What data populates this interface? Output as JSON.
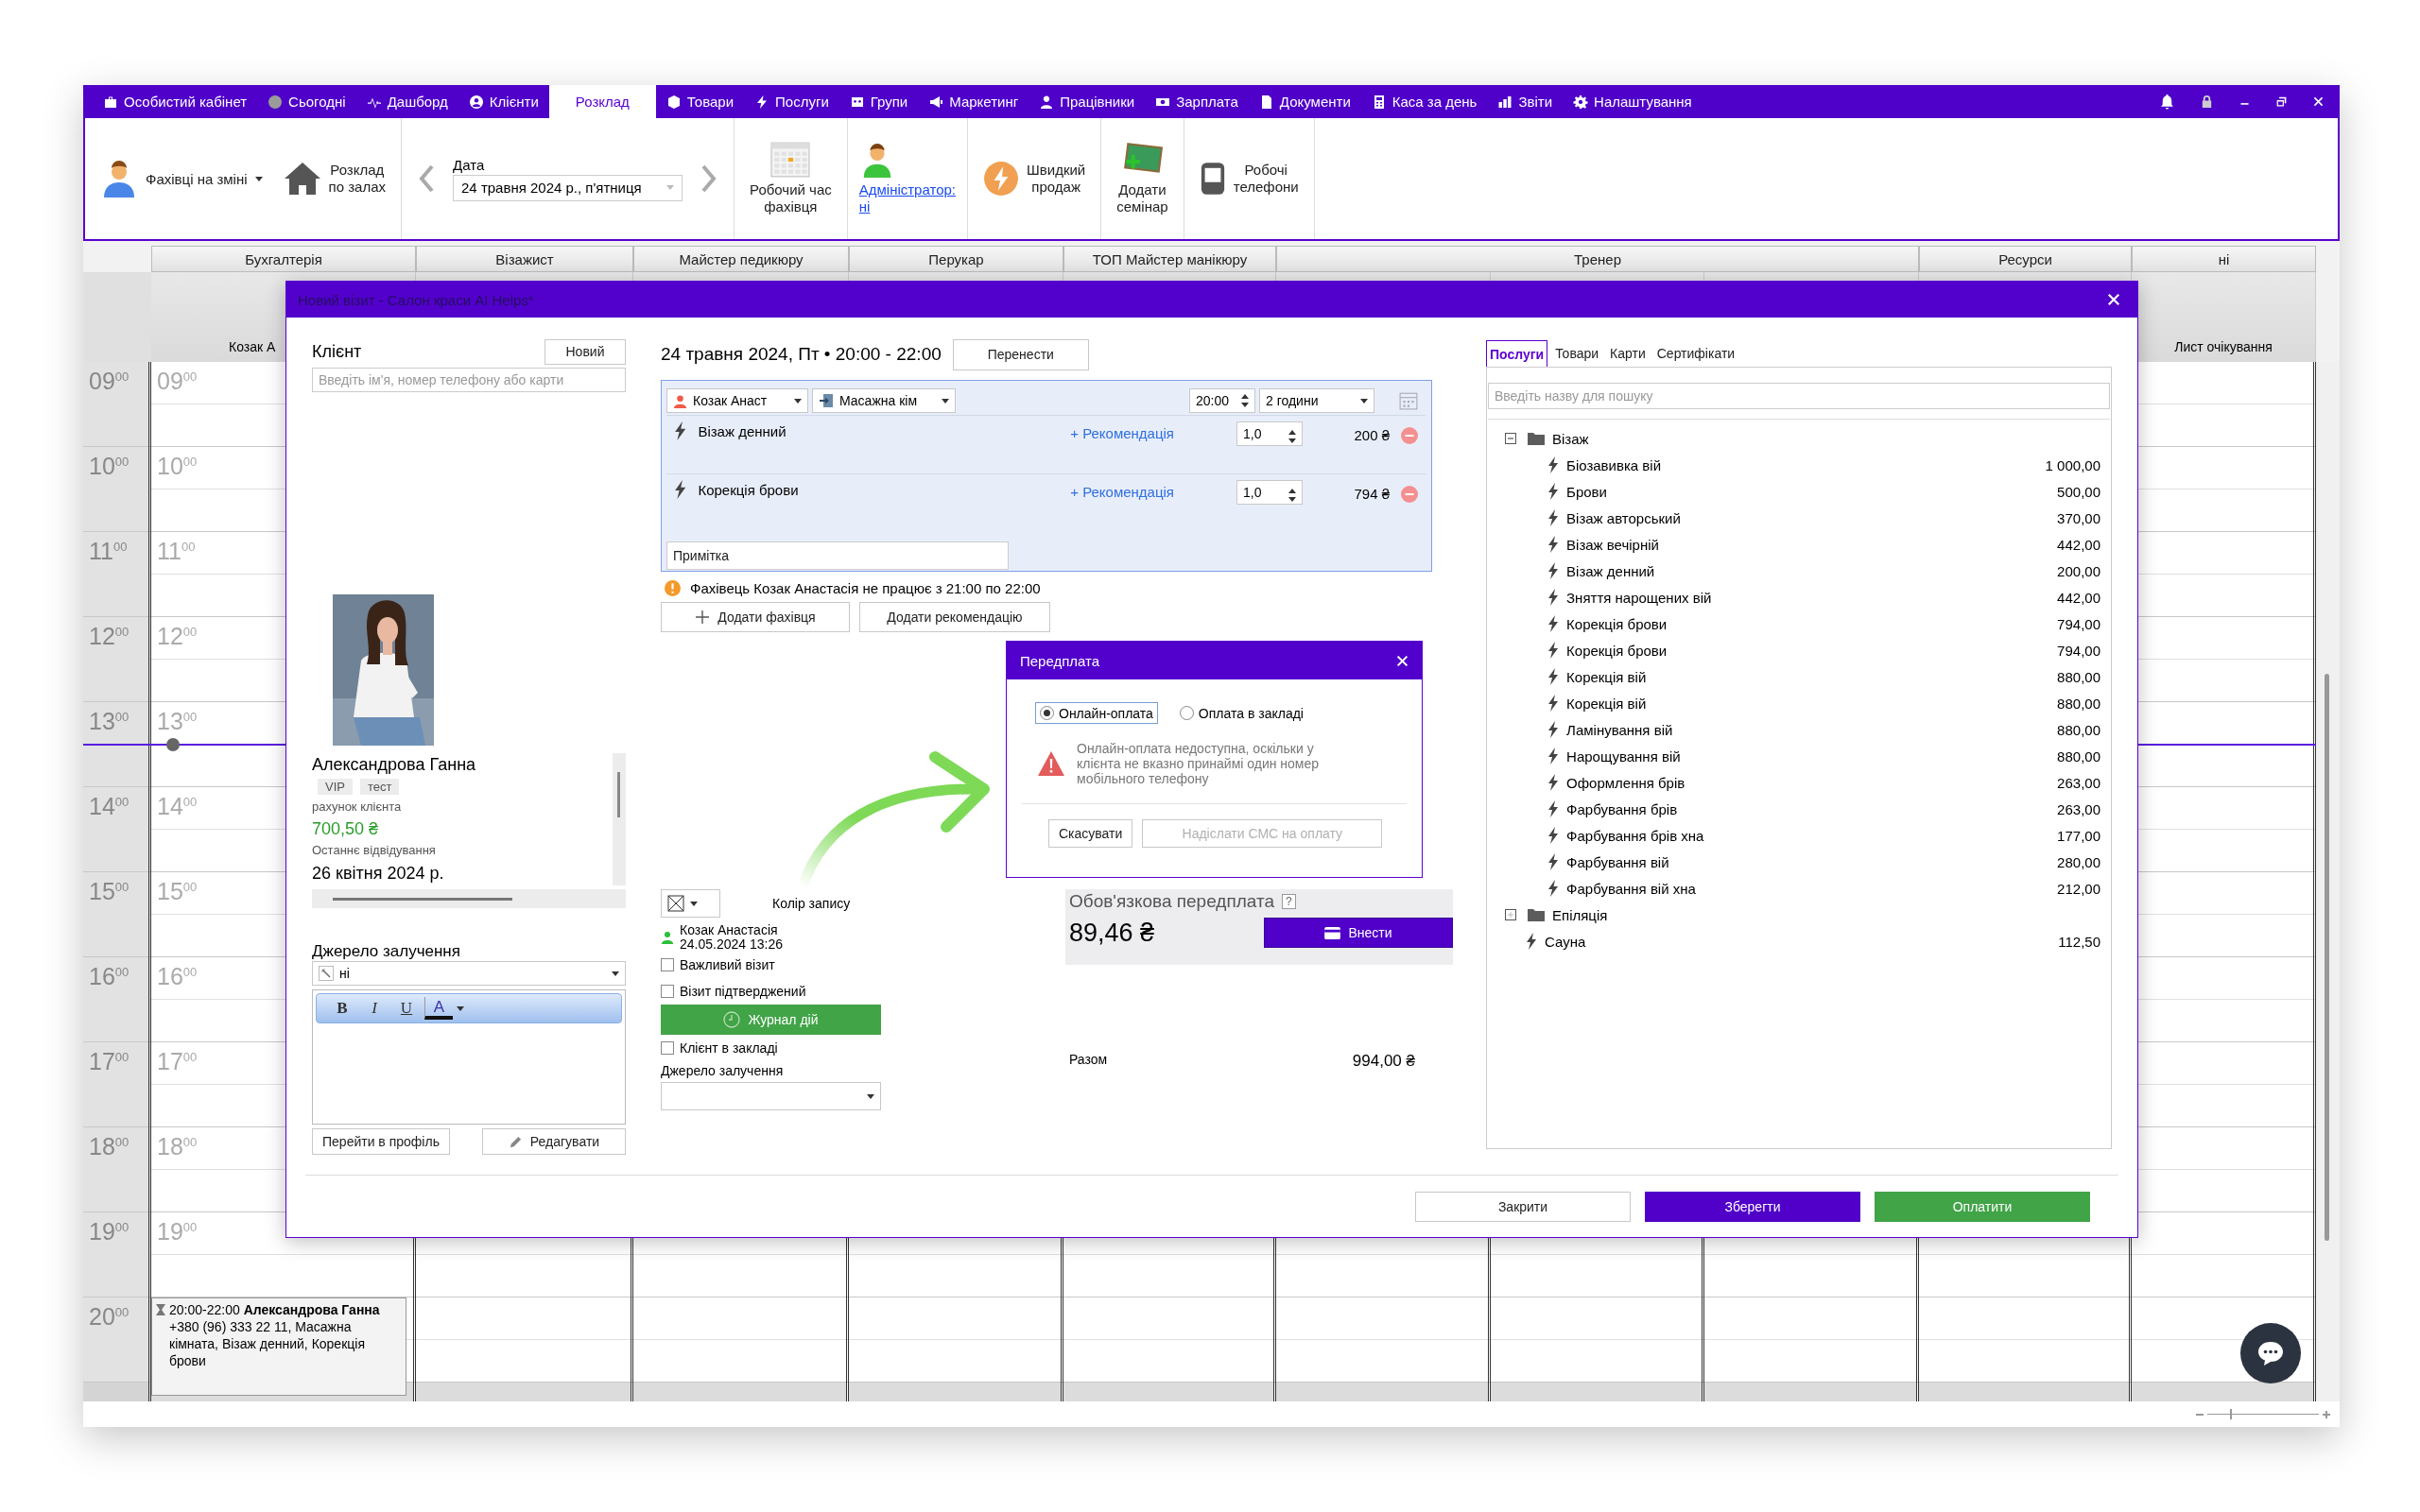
{
  "nav": {
    "items": [
      {
        "label": "Особистий кабінет",
        "selected": false
      },
      {
        "label": "Сьогодні",
        "selected": false
      },
      {
        "label": "Дашборд",
        "selected": false
      },
      {
        "label": "Клієнти",
        "selected": false
      },
      {
        "label": "Розклад",
        "selected": true
      },
      {
        "label": "Товари",
        "selected": false
      },
      {
        "label": "Послуги",
        "selected": false
      },
      {
        "label": "Групи",
        "selected": false
      },
      {
        "label": "Маркетинг",
        "selected": false
      },
      {
        "label": "Працівники",
        "selected": false
      },
      {
        "label": "Зарплата",
        "selected": false
      },
      {
        "label": "Документи",
        "selected": false
      },
      {
        "label": "Каса за день",
        "selected": false
      },
      {
        "label": "Звіти",
        "selected": false
      },
      {
        "label": "Налаштування",
        "selected": false
      }
    ]
  },
  "toolbar": {
    "staff_on_shift": "Фахівці на зміні",
    "halls_schedule": "Розклад\nпо залах",
    "date_label": "Дата",
    "date_value": "24 травня 2024 р., п'ятниця",
    "working_time": "Робочий час\nфахівця",
    "administrator": "Адміністратор:\nні",
    "quick_sale": "Швидкий\nпродаж",
    "add_seminar": "Додати\nсемінар",
    "work_phones": "Робочі\nтелефони"
  },
  "calendar": {
    "departments": [
      "Бухгалтерія",
      "Візажист",
      "Майстер педикюру",
      "Перукар",
      "ТОП Майстер манікюру",
      "Тренер",
      "Ресурси",
      "ні"
    ],
    "first_staff": "Козак А",
    "waiting_list": "Лист очікування",
    "zoom_slider": {
      "level": 0.2
    },
    "hours": [
      {
        "time": "09$^{00}$",
        "slot": "09$^{00}$",
        "now": false
      },
      {
        "time": "10$^{00}$",
        "slot": "10$^{00}$",
        "now": false
      },
      {
        "time": "11$^{00}$",
        "slot": "11$^{00}$",
        "now": false
      },
      {
        "time": "12$^{00}$",
        "slot": "12$^{00}$",
        "now": false
      },
      {
        "time": "13$^{00}$",
        "slot": "13$^{00}$",
        "now": true
      },
      {
        "time": "14$^{00}$",
        "slot": "14$^{00}$",
        "now": false
      },
      {
        "time": "15$^{00}$",
        "slot": "15$^{00}$",
        "now": false
      },
      {
        "time": "16$^{00}$",
        "slot": "16$^{00}$",
        "now": false
      },
      {
        "time": "17$^{00}$",
        "slot": "17$^{00}$",
        "now": false
      },
      {
        "time": "18$^{00}$",
        "slot": "18$^{00}$",
        "now": false
      },
      {
        "time": "19$^{00}$",
        "slot": "19$^{00}$",
        "now": false
      },
      {
        "time": "20$^{00}$",
        "now": false,
        "appointment": "20:00-22:00 **Александрова Ганна** +380 (96) 333 22 11, Масажна кімната, Візаж денний, Корекція брови"
      }
    ]
  },
  "visit_dialog": {
    "title": "Новий візит - Салон краси AI Helps*",
    "client": {
      "heading": "Клієнт",
      "new_button": "Новий",
      "search_placeholder": "Введіть ім'я, номер телефону або карти",
      "name": "Александрова Ганна",
      "tags": [
        "VIP",
        "тест"
      ],
      "balance_label": "рахунок клієнта",
      "balance": "700,50 ₴",
      "last_visit_label": "Останнє відвідування",
      "last_visit": "26 квітня 2024 р.",
      "source_label": "Джерело залучення",
      "source_value": "ні",
      "editor_tools": [
        "B",
        "I",
        "U",
        "A"
      ],
      "profile_button": "Перейти в профіль",
      "edit_button": "Редагувати"
    },
    "visit": {
      "date": "24 травня 2024, Пт • 20:00 - 22:00",
      "reschedule_button": "Перенести",
      "specialist": "Козак Анаст",
      "room": "Масажна кім",
      "start_time": "20:00",
      "duration": "2 години",
      "services": [
        {
          "name": "Візаж денний",
          "recommend": "+ Рекомендація",
          "quantity": "1,0",
          "price": "200 ₴"
        },
        {
          "name": "Корекція брови",
          "recommend": "+ Рекомендація",
          "quantity": "1,0",
          "price": "794 ₴"
        }
      ],
      "note_placeholder": "Примітка",
      "warning": "Фахівець Козак Анастасія не працює з 21:00 по 22:00",
      "add_specialist_button": "Додати фахівця",
      "add_recommendation_button": "Додати рекомендацію",
      "color_label": "Колір запису",
      "author": "Козак Анастасія",
      "created": "24.05.2024 13:26",
      "checkboxes": [
        {
          "label": "Важливий візит",
          "checked": false
        },
        {
          "label": "Візит підтверджений",
          "checked": false
        }
      ],
      "journal_button": "Журнал дій",
      "in_salon": {
        "label": "Клієнт в закладі",
        "checked": false
      },
      "source_label": "Джерело залучення"
    },
    "prepayment": {
      "title": "Обов'язкова передплата",
      "help": "?",
      "amount": "89,46 ₴",
      "pay_button": "Внести",
      "total_label": "Разом",
      "total": "994,00 ₴"
    },
    "catalog": {
      "tabs": [
        {
          "label": "Послуги",
          "selected": true
        },
        {
          "label": "Товари",
          "selected": false
        },
        {
          "label": "Карти",
          "selected": false
        },
        {
          "label": "Сертифікати",
          "selected": false
        }
      ],
      "search_placeholder": "Введіть назву для пошуку",
      "tree": [
        {
          "kind": "folder",
          "name": "Візаж",
          "expanded": true,
          "children": [
            {
              "kind": "service",
              "name": "Біозавивка вій",
              "price": "1 000,00"
            },
            {
              "kind": "service",
              "name": "Брови",
              "price": "500,00"
            },
            {
              "kind": "service",
              "name": "Візаж авторський",
              "price": "370,00"
            },
            {
              "kind": "service",
              "name": "Візаж вечірній",
              "price": "442,00"
            },
            {
              "kind": "service",
              "name": "Візаж денний",
              "price": "200,00"
            },
            {
              "kind": "service",
              "name": "Зняття нарощених вій",
              "price": "442,00"
            },
            {
              "kind": "service",
              "name": "Корекція брови",
              "price": "794,00"
            },
            {
              "kind": "service",
              "name": "Корекція брови",
              "price": "794,00"
            },
            {
              "kind": "service",
              "name": "Корекція вій",
              "price": "880,00"
            },
            {
              "kind": "service",
              "name": "Корекція вій",
              "price": "880,00"
            },
            {
              "kind": "service",
              "name": "Ламінування вій",
              "price": "880,00"
            },
            {
              "kind": "service",
              "name": "Нарощування вій",
              "price": "880,00"
            },
            {
              "kind": "service",
              "name": "Оформлення брів",
              "price": "263,00"
            },
            {
              "kind": "service",
              "name": "Фарбування брів",
              "price": "263,00"
            },
            {
              "kind": "service",
              "name": "Фарбування брів хна",
              "price": "177,00"
            },
            {
              "kind": "service",
              "name": "Фарбування вій",
              "price": "280,00"
            },
            {
              "kind": "service",
              "name": "Фарбування вій хна",
              "price": "212,00"
            }
          ]
        },
        {
          "kind": "folder",
          "name": "Епіляція",
          "expanded": false
        },
        {
          "kind": "service",
          "name": "Сауна",
          "price": "112,50"
        }
      ]
    },
    "footer_buttons": [
      {
        "label": "Закрити",
        "kind": "plain"
      },
      {
        "label": "Зберегти",
        "kind": "primary"
      },
      {
        "label": "Оплатити",
        "kind": "pay"
      }
    ]
  },
  "prepay_dialog": {
    "title": "Передплата",
    "options": [
      {
        "label": "Онлайн-оплата",
        "selected": true
      },
      {
        "label": "Оплата в закладі",
        "selected": false
      }
    ],
    "message": "Онлайн-оплата недоступна, оскільки у клієнта не вказно принаймі один номер мобільного телефону",
    "cancel_button": "Скасувати",
    "send_button": {
      "label": "Надіслати СМС на оплату",
      "disabled": true
    }
  }
}
